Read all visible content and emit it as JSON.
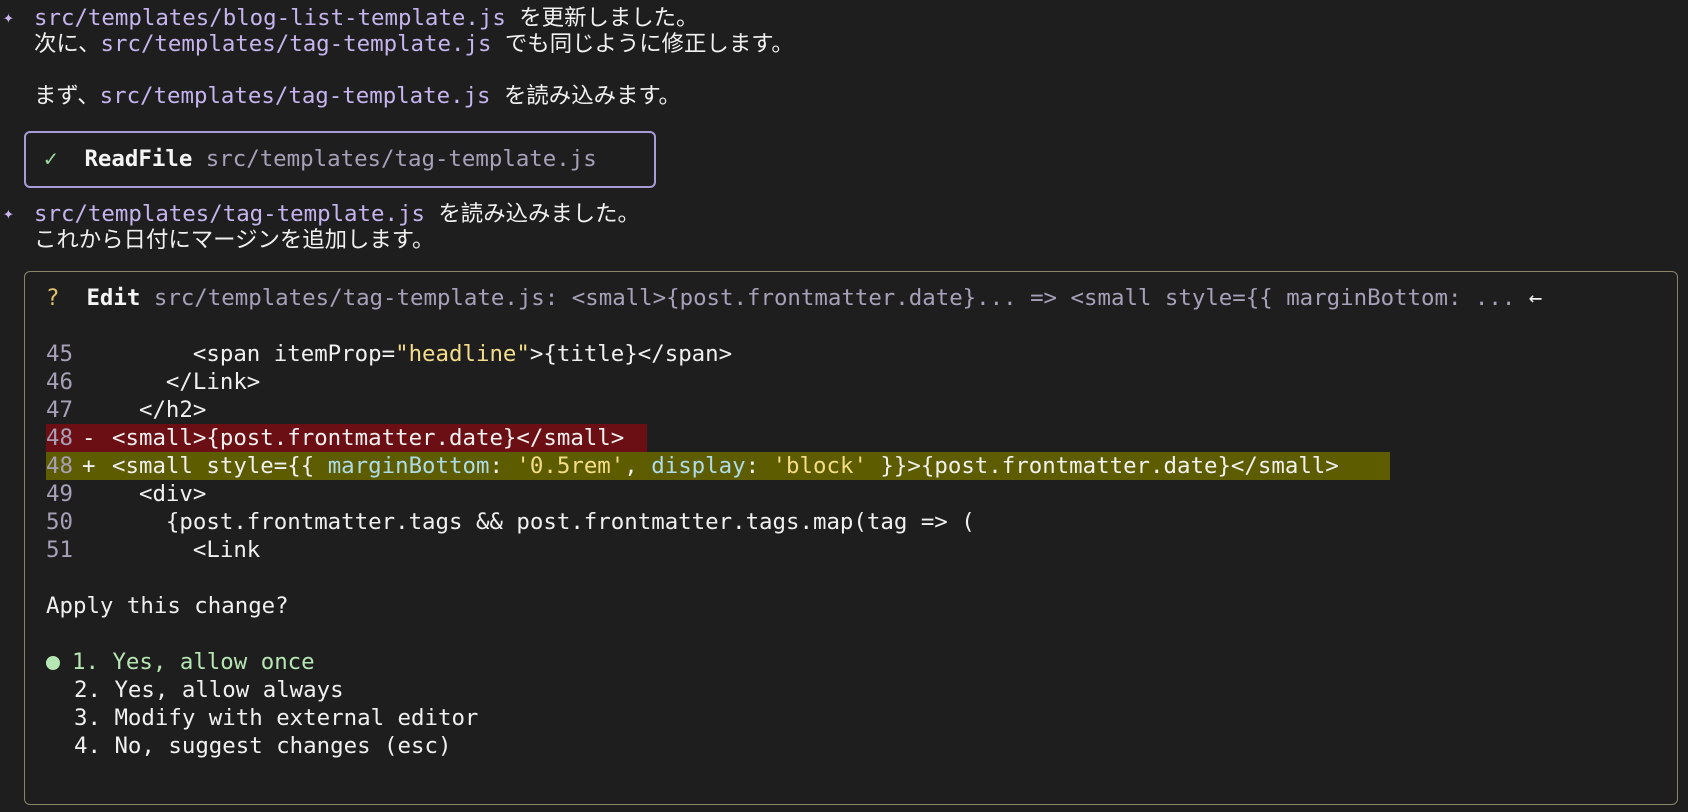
{
  "messages": [
    {
      "path": "src/templates/blog-list-template.js",
      "suffix": " を更新しました。",
      "line2_prefix": "次に、",
      "line2_path": "src/templates/tag-template.js",
      "line2_suffix": " でも同じように修正します。",
      "line3_prefix": "まず、",
      "line3_path": "src/templates/tag-template.js",
      "line3_suffix": " を読み込みます。"
    },
    {
      "path": "src/templates/tag-template.js",
      "suffix": " を読み込みました。",
      "line2": "これから日付にマージンを追加します。"
    }
  ],
  "star_glyph": "✦",
  "readfile_tool": {
    "check_glyph": "✓",
    "name": "ReadFile",
    "arg": "src/templates/tag-template.js"
  },
  "edit_tool": {
    "question_glyph": "?",
    "name": "Edit",
    "summary": "src/templates/tag-template.js: <small>{post.frontmatter.date}... => <small style={{ marginBottom: ...",
    "arrow_glyph": "←"
  },
  "diff": {
    "l45": {
      "num": "45",
      "pre": "      <span itemProp=",
      "str": "\"headline\"",
      "post": ">{title}</span>"
    },
    "l46": {
      "num": "46",
      "code": "    </Link>"
    },
    "l47": {
      "num": "47",
      "code": "  </h2>"
    },
    "l48del": {
      "num": "48",
      "sign": "-",
      "code": "<small>{post.frontmatter.date}</small>"
    },
    "l48add": {
      "num": "48",
      "sign": "+",
      "a": "<small style={{ ",
      "p1": "marginBottom",
      "b": ": ",
      "s1": "'0.5rem'",
      "c": ", ",
      "p2": "display",
      "d": ": ",
      "s2": "'block'",
      "e": " }}>{post.frontmatter.date}</small>"
    },
    "l49": {
      "num": "49",
      "code": "  <div>"
    },
    "l50": {
      "num": "50",
      "code": "    {post.frontmatter.tags && post.frontmatter.tags.map(tag => ("
    },
    "l51": {
      "num": "51",
      "code": "      <Link"
    }
  },
  "prompt": "Apply this change?",
  "options": [
    "1. Yes, allow once",
    "2. Yes, allow always",
    "3. Modify with external editor",
    "4. No, suggest changes (esc)"
  ],
  "colors": {
    "background": "#1e1e1e",
    "path": "#c5b4ee",
    "readfile_border": "#a89cd6",
    "edit_border": "#8a8468",
    "diff_delete_bg": "#6b0f14",
    "diff_add_bg": "#5e5c00",
    "selected_option": "#b6e6b3"
  }
}
